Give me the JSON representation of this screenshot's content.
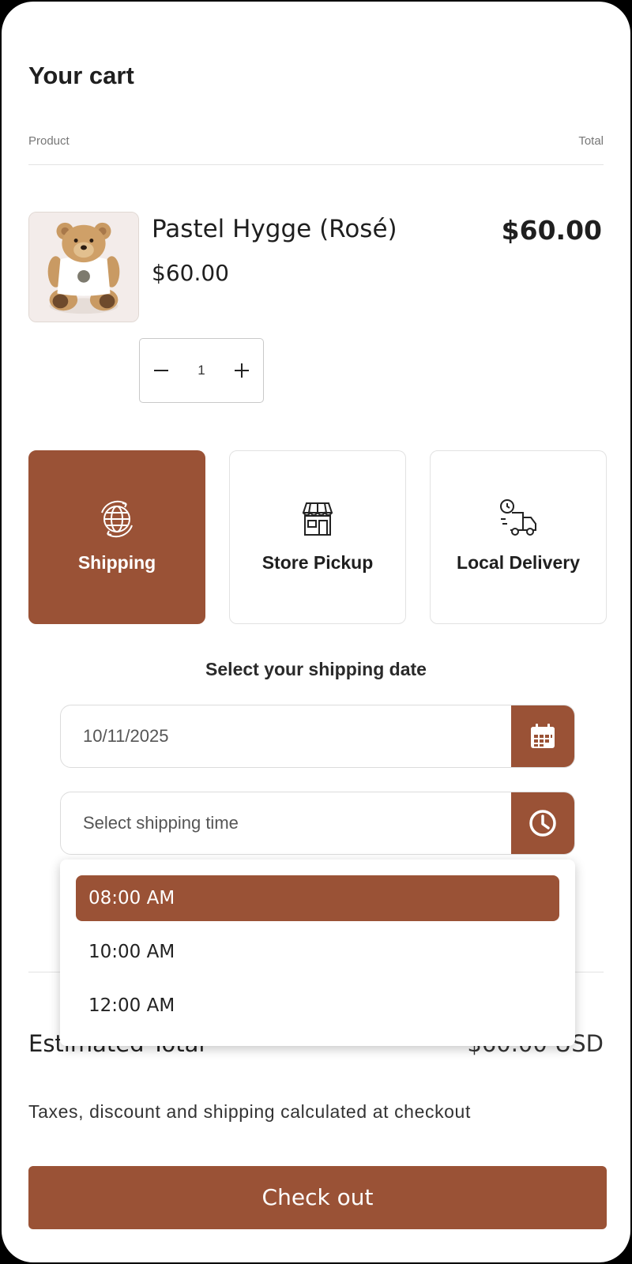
{
  "cart": {
    "title": "Your cart",
    "columns": {
      "product": "Product",
      "total": "Total"
    }
  },
  "item": {
    "name": "Pastel Hygge (Rosé)",
    "price": "$60.00",
    "line_total": "$60.00",
    "quantity": "1",
    "image_icon": "teddy-bear-image"
  },
  "delivery_methods": [
    {
      "label": "Shipping",
      "icon": "globe-icon",
      "selected": true
    },
    {
      "label": "Store Pickup",
      "icon": "store-icon",
      "selected": false
    },
    {
      "label": "Local Delivery",
      "icon": "delivery-truck-icon",
      "selected": false
    }
  ],
  "shipping": {
    "heading": "Select your shipping date",
    "date_value": "10/11/2025",
    "time_placeholder": "Select shipping time",
    "time_options": [
      "08:00 AM",
      "10:00 AM",
      "12:00 AM"
    ],
    "selected_time_index": 0
  },
  "summary": {
    "label": "Estimated Total",
    "value": "$60.00 USD",
    "note": "Taxes, discount and shipping calculated at checkout"
  },
  "checkout": {
    "label": "Check out"
  },
  "colors": {
    "accent": "#9a5236",
    "text": "#1f1f1f",
    "border": "#e2e2e2"
  }
}
